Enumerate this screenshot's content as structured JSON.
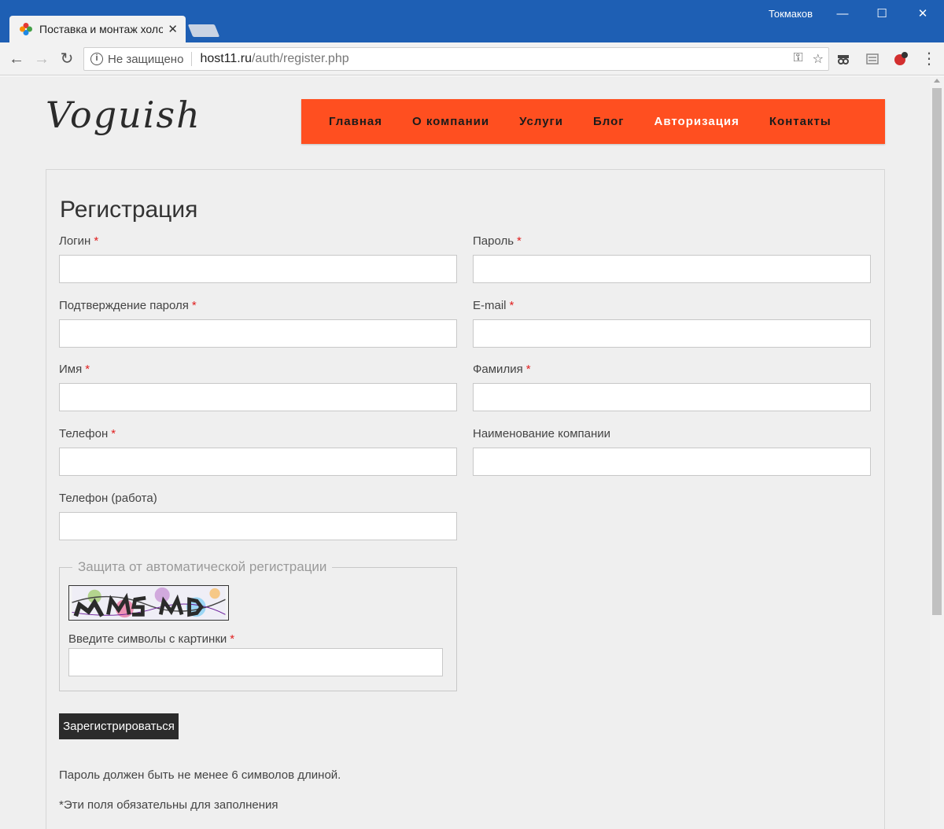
{
  "browser": {
    "tab_title": "Поставка и монтаж холо",
    "tab_close": "✕",
    "user_name": "Токмаков",
    "security_label": "Не защищено",
    "url_host": "host11.ru",
    "url_path": "/auth/register.php",
    "win_minimize": "—",
    "win_maximize": "☐",
    "win_close": "✕",
    "back": "←",
    "forward": "→",
    "reload": "↻",
    "key_icon": "⚿",
    "star_icon": "☆",
    "menu_icon": "⋮",
    "info_glyph": "i"
  },
  "site": {
    "logo": "Voguish",
    "nav": [
      {
        "label": "Главная"
      },
      {
        "label": "О компании"
      },
      {
        "label": "Услуги"
      },
      {
        "label": "Блог"
      },
      {
        "label": "Авторизация"
      },
      {
        "label": "Контакты"
      }
    ],
    "accent_color": "#ff4f20"
  },
  "form": {
    "title": "Регистрация",
    "required_mark": "*",
    "fields": {
      "login": "Логин",
      "password": "Пароль",
      "password_confirm": "Подтверждение пароля",
      "email": "E-mail",
      "first_name": "Имя",
      "last_name": "Фамилия",
      "phone": "Телефон",
      "company": "Наименование компании",
      "phone_work": "Телефон (работа)"
    },
    "captcha": {
      "legend": "Защита от автоматической регистрации",
      "label": "Введите символы с картинки"
    },
    "submit": "Зарегистрироваться",
    "note_password": "Пароль должен быть не менее 6 символов длиной.",
    "note_required": "*Эти поля обязательны для заполнения"
  }
}
